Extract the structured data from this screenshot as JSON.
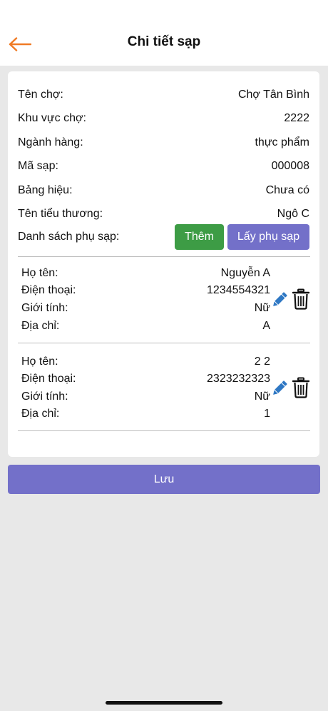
{
  "header": {
    "title": "Chi tiết sạp"
  },
  "info": [
    {
      "label": "Tên chợ:",
      "value": "Chợ Tân Bình"
    },
    {
      "label": "Khu vực chợ:",
      "value": "2222"
    },
    {
      "label": "Ngành hàng:",
      "value": "thực phẩm"
    },
    {
      "label": "Mã sạp:",
      "value": "000008"
    },
    {
      "label": "Bảng hiệu:",
      "value": "Chưa có"
    },
    {
      "label": "Tên tiểu thương:",
      "value": "Ngô  C"
    }
  ],
  "sublist": {
    "label": "Danh sách phụ sạp:",
    "add_label": "Thêm",
    "fetch_label": "Lấy phụ sạp",
    "field_labels": {
      "name": "Họ tên:",
      "phone": "Điện thoại:",
      "gender": "Giới tính:",
      "address": "Địa chỉ:"
    },
    "items": [
      {
        "name": "Nguyễn  A",
        "phone": "1234554321",
        "gender": "Nữ",
        "address": "A"
      },
      {
        "name": "2  2",
        "phone": "2323232323",
        "gender": "Nữ",
        "address": "1"
      }
    ]
  },
  "save_label": "Lưu",
  "colors": {
    "accent_orange": "#f07b25",
    "green": "#3d9c45",
    "purple": "#7370c9",
    "edit_blue": "#2f78c4"
  }
}
